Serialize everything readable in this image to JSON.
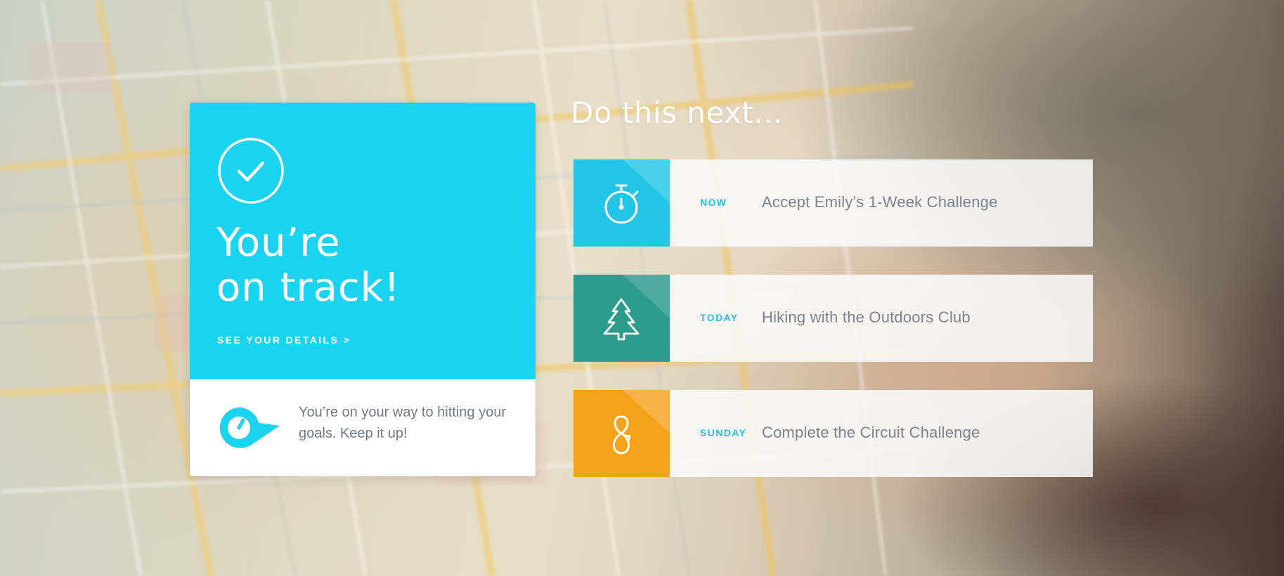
{
  "status_card": {
    "icon": "check-circle-icon",
    "title_line1": "You’re",
    "title_line2": "on track!",
    "details_link": "SEE YOUR DETAILS >",
    "message_icon": "location-pin-icon",
    "message": "You’re on your way to hitting your goals. Keep it up!",
    "accent_color": "#1ad3ee"
  },
  "next": {
    "heading": "Do this next...",
    "tasks": [
      {
        "when": "NOW",
        "label": "Accept Emily’s 1-Week Challenge",
        "icon": "stopwatch-icon",
        "color": "#22c5e6"
      },
      {
        "when": "TODAY",
        "label": "Hiking with the Outdoors Club",
        "icon": "pine-tree-icon",
        "color": "#2d9c8c"
      },
      {
        "when": "SUNDAY",
        "label": "Complete the Circuit Challenge",
        "icon": "circuit-loop-icon",
        "color": "#f5a21b"
      }
    ]
  }
}
